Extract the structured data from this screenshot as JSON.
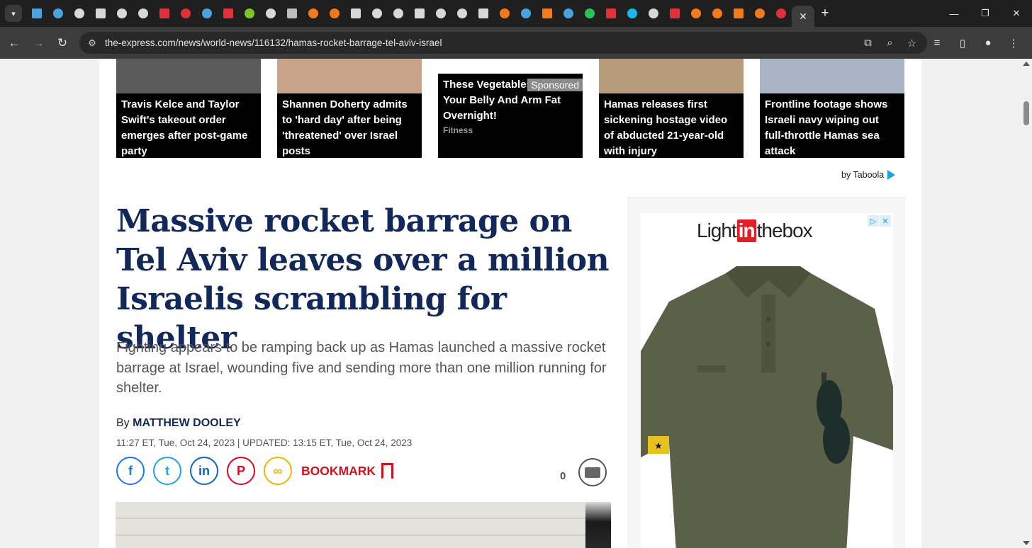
{
  "browser": {
    "url": "the-express.com/news/world-news/116132/hamas-rocket-barrage-tel-aviv-israel",
    "tab_favicon_colors": [
      "#4aa3df",
      "#4aa3df",
      "#d8d8d8",
      "#d8d8d8",
      "#d8d8d8",
      "#d8d8d8",
      "#e0303a",
      "#e0303a",
      "#4aa3df",
      "#e0303a",
      "#7cc52a",
      "#d8d8d8",
      "#bdbdbd",
      "#f27a1a",
      "#f27a1a",
      "#d8d8d8",
      "#d8d8d8",
      "#d8d8d8",
      "#d8d8d8",
      "#d8d8d8",
      "#d8d8d8",
      "#d8d8d8",
      "#f27a1a",
      "#4aa3df",
      "#f27a1a",
      "#4aa3df",
      "#2bbf56",
      "#e0303a",
      "#19b7ea",
      "#d8d8d8",
      "#e0303a",
      "#f27a1a",
      "#f27a1a",
      "#f27a1a",
      "#f27a1a",
      "#e0303a"
    ],
    "icons": {
      "tab_search": "chevron-down-icon",
      "close_tab": "close-icon",
      "new_tab": "plus-icon",
      "back": "arrow-left-icon",
      "forward": "arrow-right-icon",
      "reload": "reload-icon",
      "site_info": "tune-icon",
      "install": "install-app-icon",
      "zoom": "zoom-icon",
      "star": "star-icon",
      "reading_list": "reading-list-icon",
      "side_panel": "side-panel-icon",
      "profile": "profile-icon",
      "menu": "kebab-menu-icon"
    }
  },
  "recommendations": [
    {
      "title": "Travis Kelce and Taylor Swift's takeout order emerges after post-game party",
      "brand": "",
      "sponsored": "",
      "photo_color": "#5a5a5a"
    },
    {
      "title": "Shannen Doherty admits to 'hard day' after being 'threatened' over Israel posts",
      "brand": "",
      "sponsored": "",
      "photo_color": "#c9a48a"
    },
    {
      "title": "These Vegetables Will Kill Your Belly And Arm Fat Overnight!",
      "brand": "Fitness",
      "sponsored": "Sponsored",
      "photo_color": "#ffffff"
    },
    {
      "title": "Hamas releases first sickening hostage video of abducted 21-year-old with injury",
      "brand": "",
      "sponsored": "",
      "photo_color": "#b79a7a"
    },
    {
      "title": "Frontline footage shows Israeli navy wiping out full-throttle Hamas sea attack",
      "brand": "",
      "sponsored": "",
      "photo_color": "#a9b4c4"
    }
  ],
  "taboola": {
    "label": "by Taboola"
  },
  "article": {
    "headline": "Massive rocket barrage on Tel Aviv leaves over a million Israelis scrambling for shelter",
    "standfirst": "Fighting appears to be ramping back up as Hamas launched a massive rocket barrage at Israel, wounding five and sending more than one million running for shelter.",
    "by_prefix": "By ",
    "author": "MATTHEW DOOLEY",
    "dateline": "11:27 ET, Tue, Oct 24, 2023 | UPDATED: 13:15 ET, Tue, Oct 24, 2023",
    "bookmark_label": "BOOKMARK",
    "comment_count": "0",
    "headline_color": "#13285a"
  },
  "share": [
    {
      "name": "facebook",
      "glyph": "f",
      "color": "#1877f2"
    },
    {
      "name": "twitter",
      "glyph": "t",
      "color": "#1da1f2"
    },
    {
      "name": "linkedin",
      "glyph": "in",
      "color": "#0a66c2"
    },
    {
      "name": "pinterest",
      "glyph": "P",
      "color": "#e60023"
    },
    {
      "name": "copy-link",
      "glyph": "∞",
      "color": "#f2b400"
    }
  ],
  "ad": {
    "logo_left": "Light",
    "logo_mid": "in",
    "logo_right": "thebox",
    "adchoices": [
      "▷",
      "✕"
    ]
  }
}
